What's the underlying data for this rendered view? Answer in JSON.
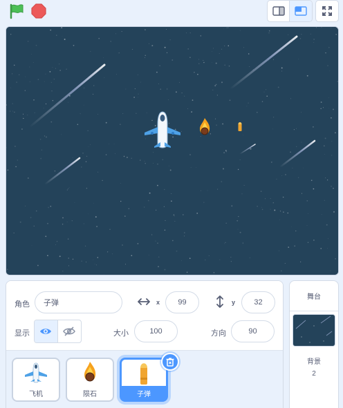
{
  "colors": {
    "accent": "#4c97ff",
    "stage_bg": "#24435a",
    "flag": "#4cbf56",
    "stop": "#ec5959",
    "panel_bg": "#e9f1fc"
  },
  "topbar": {
    "green_flag_icon": "green-flag-icon",
    "stop_icon": "stop-sign-icon",
    "small_stage_icon": "small-stage-icon",
    "normal_stage_icon": "normal-stage-icon",
    "fullscreen_icon": "fullscreen-icon"
  },
  "sprite_info": {
    "sprite_label": "角色",
    "sprite_name": "子弹",
    "x_label": "x",
    "x_value": "99",
    "y_label": "y",
    "y_value": "32",
    "show_label": "显示",
    "size_label": "大小",
    "size_value": "100",
    "direction_label": "方向",
    "direction_value": "90"
  },
  "sprites": [
    {
      "name": "飞机",
      "icon": "airplane-icon"
    },
    {
      "name": "陨石",
      "icon": "meteor-icon"
    },
    {
      "name": "子弹",
      "icon": "bullet-icon",
      "selected": true
    }
  ],
  "stage_panel": {
    "title": "舞台",
    "backdrops_label": "背景",
    "backdrops_count": "2"
  }
}
